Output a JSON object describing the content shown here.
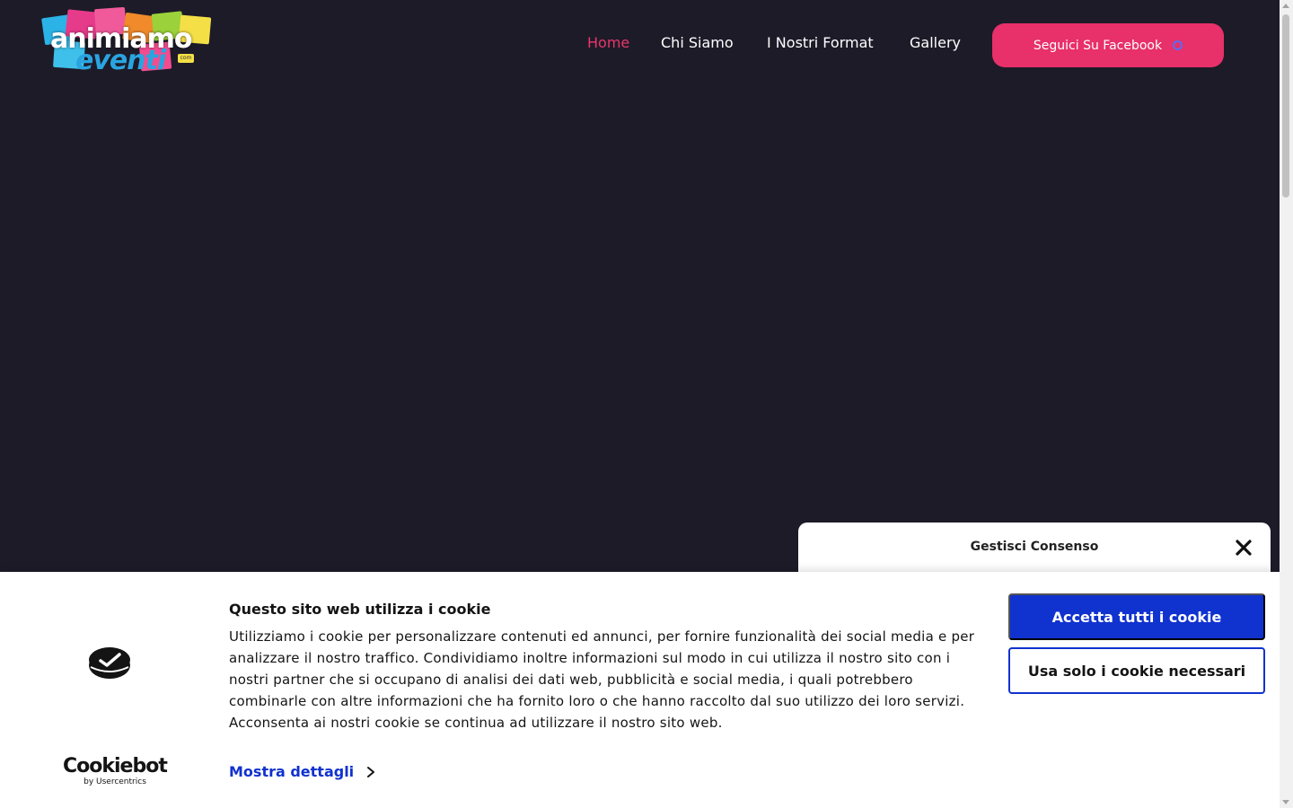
{
  "header": {
    "logo": {
      "word1": "animiamo",
      "word2": "eventi",
      "suffix": "com"
    },
    "nav": [
      {
        "label": "Home",
        "active": true
      },
      {
        "label": "Chi Siamo",
        "active": false
      },
      {
        "label": "I Nostri Format",
        "active": false
      },
      {
        "label": "Gallery",
        "active": false
      }
    ],
    "cta_label": "Seguici Su Facebook",
    "cta_icon": "facebook-icon"
  },
  "consent_panel": {
    "title": "Gestisci Consenso",
    "close_icon": "close-icon"
  },
  "cookie_banner": {
    "title": "Questo sito web utilizza i cookie",
    "body": "Utilizziamo i cookie per personalizzare contenuti ed annunci, per fornire funzionalità dei social media e per analizzare il nostro traffico. Condividiamo inoltre informazioni sul modo in cui utilizza il nostro sito con i nostri partner che si occupano di analisi dei dati web, pubblicità e social media, i quali potrebbero combinarle con altre informazioni che ha fornito loro o che hanno raccolto dal suo utilizzo dei loro servizi. Acconsenta ai nostri cookie se continua ad utilizzare il nostro sito web.",
    "details_label": "Mostra dettagli",
    "accept_label": "Accetta tutti i cookie",
    "necessary_label": "Usa solo i cookie necessari",
    "brand_name": "Cookiebot",
    "brand_by": "by Usercentrics"
  },
  "colors": {
    "background": "#1d1b28",
    "accent": "#e8306a",
    "cookie_blue": "#1032cf"
  }
}
